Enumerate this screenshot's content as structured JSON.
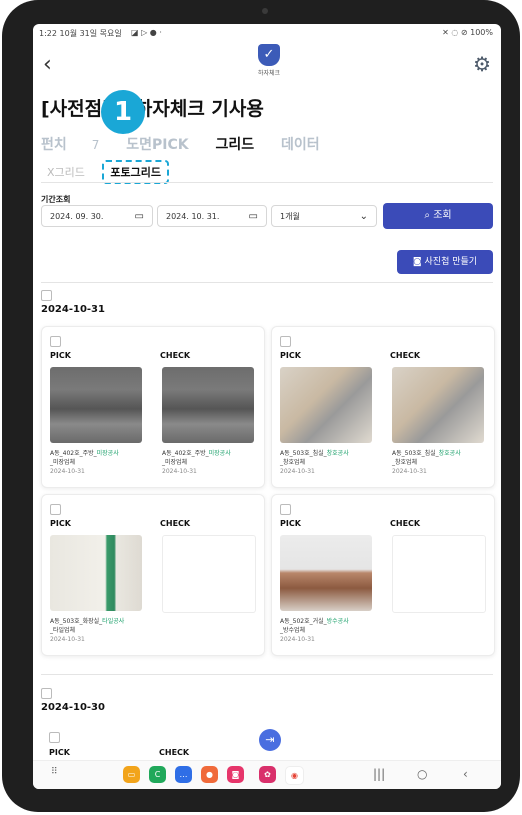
{
  "status_bar": {
    "time_date": "1:22 10월 31일 목요일",
    "indicators": "◪ ▷ ● ·",
    "right": "✕ ◌ ⊘ 100%"
  },
  "header": {
    "back_icon": "chevron-left-icon",
    "logo_text": "하자체크",
    "settings_icon": "gear-icon"
  },
  "page_title": "[사전점검] 하자체크 기사용",
  "badge_number": "1",
  "tabs": [
    {
      "label": "펀치",
      "count": "7"
    },
    {
      "label": "도면PICK",
      "count": ""
    },
    {
      "label": "그리드",
      "count": ""
    },
    {
      "label": "데이터",
      "count": ""
    }
  ],
  "active_tab": "그리드",
  "subtabs": [
    {
      "label": "X그리드"
    },
    {
      "label": "포토그리드"
    }
  ],
  "active_subtab": "포토그리드",
  "filter": {
    "period_label": "기간조회",
    "start_date": "2024. 09. 30.",
    "end_date": "2024. 10. 31.",
    "range_select": "1개월",
    "search_label": "조회",
    "album_label": "사진첩 만들기"
  },
  "groups": [
    {
      "date": "2024-10-31",
      "cards": [
        {
          "pick_label": "PICK",
          "check_label": "CHECK",
          "pick_caption_1": "A동_402호_주방_",
          "pick_caption_green": "미장공사",
          "pick_caption_2": "_미장업체",
          "pick_date": "2024-10-31",
          "check_caption_1": "A동_402호_주방_",
          "check_caption_green": "미장공사",
          "check_caption_2": "_미장업체",
          "check_date": "2024-10-31"
        },
        {
          "pick_label": "PICK",
          "check_label": "CHECK",
          "pick_caption_1": "A동_503호_침실_",
          "pick_caption_green": "창호공사",
          "pick_caption_2": "_창호업체",
          "pick_date": "2024-10-31",
          "check_caption_1": "A동_503호_침실_",
          "check_caption_green": "창호공사",
          "check_caption_2": "_창호업체",
          "check_date": "2024-10-31"
        },
        {
          "pick_label": "PICK",
          "check_label": "CHECK",
          "pick_caption_1": "A동_503호_화장실_",
          "pick_caption_green": "타일공사",
          "pick_caption_2": "_타일업체",
          "pick_date": "2024-10-31"
        },
        {
          "pick_label": "PICK",
          "check_label": "CHECK",
          "pick_caption_1": "A동_502호_거실_",
          "pick_caption_green": "방수공사",
          "pick_caption_2": "_방수업체",
          "pick_date": "2024-10-31"
        }
      ]
    },
    {
      "date": "2024-10-30",
      "cards": [
        {
          "pick_label": "PICK",
          "check_label": "CHECK"
        }
      ]
    }
  ],
  "bottom_nav": {
    "apps": [
      "folder-icon",
      "phone-icon",
      "message-icon",
      "contacts-icon",
      "camera-icon",
      "gallery-icon",
      "chrome-icon"
    ],
    "system": [
      "recents-icon",
      "home-icon",
      "back-icon"
    ]
  },
  "colors": {
    "primary": "#3b4bb8",
    "highlight": "#1aa7d6",
    "green": "#1aa06a"
  }
}
